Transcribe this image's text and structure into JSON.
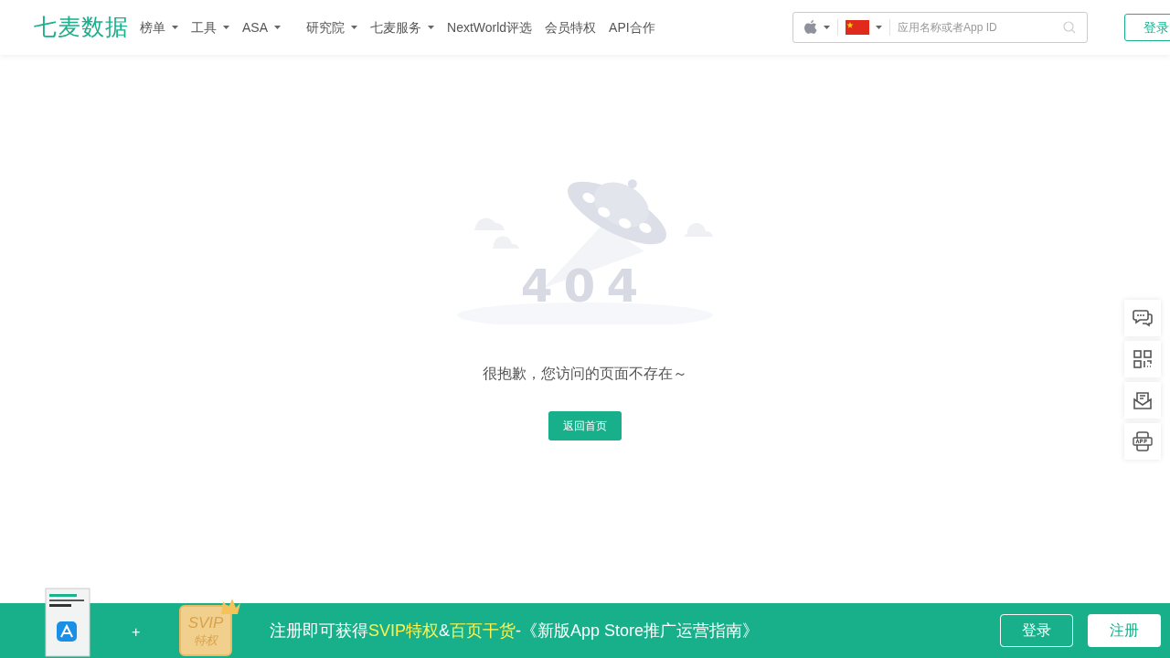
{
  "header": {
    "logo": "七麦数据",
    "nav": [
      {
        "label": "榜单",
        "dropdown": true
      },
      {
        "label": "工具",
        "dropdown": true
      },
      {
        "label": "ASA",
        "dropdown": true
      },
      {
        "label": "研究院",
        "dropdown": true
      },
      {
        "label": "七麦服务",
        "dropdown": true
      },
      {
        "label": "NextWorld评选",
        "dropdown": false
      },
      {
        "label": "会员特权",
        "dropdown": false
      },
      {
        "label": "API合作",
        "dropdown": false
      }
    ],
    "search": {
      "placeholder": "应用名称或者App ID"
    },
    "login": "登录"
  },
  "error": {
    "code": "404",
    "message": "很抱歉，您访问的页面不存在～",
    "button": "返回首页"
  },
  "side_tools": [
    {
      "kind": "chat"
    },
    {
      "kind": "qr"
    },
    {
      "kind": "mail"
    },
    {
      "kind": "app"
    }
  ],
  "banner": {
    "plus": "+",
    "badge_top": "SVIP",
    "badge_bottom": "特权",
    "segments": [
      {
        "text": "注册即可获得",
        "highlight": false
      },
      {
        "text": "SVIP特权",
        "highlight": true
      },
      {
        "text": "&",
        "highlight": false
      },
      {
        "text": "百页干货",
        "highlight": true
      },
      {
        "text": "-《新版App Store推广运营指南》",
        "highlight": false
      }
    ],
    "login": "登录",
    "register": "注册"
  }
}
